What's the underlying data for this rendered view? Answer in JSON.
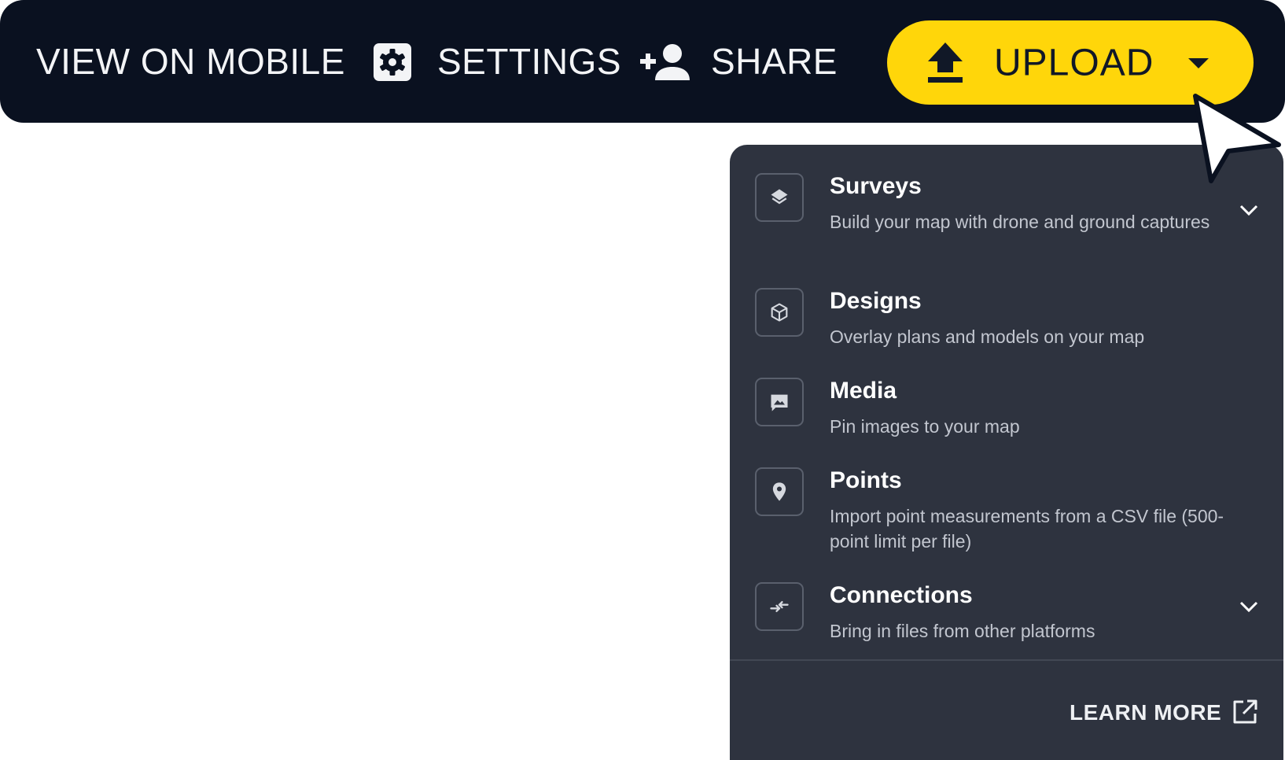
{
  "toolbar": {
    "view_on_mobile": "VIEW ON MOBILE",
    "settings": "SETTINGS",
    "share": "SHARE",
    "upload": "UPLOAD",
    "settings_icon": "gear-icon",
    "share_icon": "person-add-icon",
    "upload_icon": "upload-arrow-icon",
    "upload_dropdown_icon": "caret-down-icon"
  },
  "colors": {
    "toolbar_bg": "#0a1120",
    "upload_accent": "#ffd60a",
    "panel_bg": "#2e333f",
    "page_bg": "#ffffff"
  },
  "upload_menu": {
    "items": [
      {
        "title": "Surveys",
        "description": "Build your map with drone and ground captures",
        "icon": "layers-icon",
        "has_submenu": true
      },
      {
        "title": "Designs",
        "description": "Overlay plans and models on your map",
        "icon": "cube-icon",
        "has_submenu": false
      },
      {
        "title": "Media",
        "description": "Pin images to your map",
        "icon": "image-icon",
        "has_submenu": false
      },
      {
        "title": "Points",
        "description": "Import point measurements from a CSV file (500-point limit per file)",
        "icon": "map-pin-icon",
        "has_submenu": false
      },
      {
        "title": "Connections",
        "description": "Bring in files from other platforms",
        "icon": "connect-arrows-icon",
        "has_submenu": true
      }
    ],
    "learn_more": "LEARN MORE",
    "learn_more_icon": "external-link-icon"
  }
}
